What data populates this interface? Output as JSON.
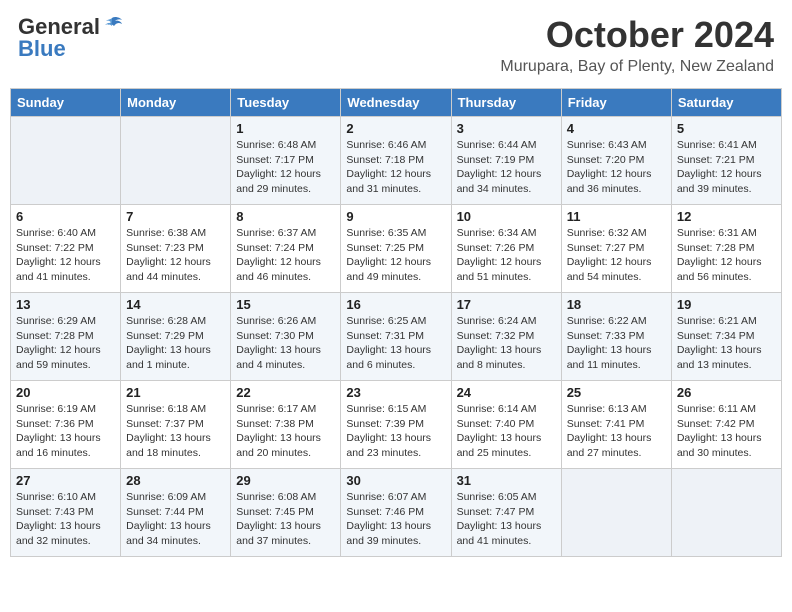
{
  "header": {
    "logo_general": "General",
    "logo_blue": "Blue",
    "month_title": "October 2024",
    "location": "Murupara, Bay of Plenty, New Zealand"
  },
  "weekdays": [
    "Sunday",
    "Monday",
    "Tuesday",
    "Wednesday",
    "Thursday",
    "Friday",
    "Saturday"
  ],
  "weeks": [
    [
      {
        "day": "",
        "info": ""
      },
      {
        "day": "",
        "info": ""
      },
      {
        "day": "1",
        "info": "Sunrise: 6:48 AM\nSunset: 7:17 PM\nDaylight: 12 hours\nand 29 minutes."
      },
      {
        "day": "2",
        "info": "Sunrise: 6:46 AM\nSunset: 7:18 PM\nDaylight: 12 hours\nand 31 minutes."
      },
      {
        "day": "3",
        "info": "Sunrise: 6:44 AM\nSunset: 7:19 PM\nDaylight: 12 hours\nand 34 minutes."
      },
      {
        "day": "4",
        "info": "Sunrise: 6:43 AM\nSunset: 7:20 PM\nDaylight: 12 hours\nand 36 minutes."
      },
      {
        "day": "5",
        "info": "Sunrise: 6:41 AM\nSunset: 7:21 PM\nDaylight: 12 hours\nand 39 minutes."
      }
    ],
    [
      {
        "day": "6",
        "info": "Sunrise: 6:40 AM\nSunset: 7:22 PM\nDaylight: 12 hours\nand 41 minutes."
      },
      {
        "day": "7",
        "info": "Sunrise: 6:38 AM\nSunset: 7:23 PM\nDaylight: 12 hours\nand 44 minutes."
      },
      {
        "day": "8",
        "info": "Sunrise: 6:37 AM\nSunset: 7:24 PM\nDaylight: 12 hours\nand 46 minutes."
      },
      {
        "day": "9",
        "info": "Sunrise: 6:35 AM\nSunset: 7:25 PM\nDaylight: 12 hours\nand 49 minutes."
      },
      {
        "day": "10",
        "info": "Sunrise: 6:34 AM\nSunset: 7:26 PM\nDaylight: 12 hours\nand 51 minutes."
      },
      {
        "day": "11",
        "info": "Sunrise: 6:32 AM\nSunset: 7:27 PM\nDaylight: 12 hours\nand 54 minutes."
      },
      {
        "day": "12",
        "info": "Sunrise: 6:31 AM\nSunset: 7:28 PM\nDaylight: 12 hours\nand 56 minutes."
      }
    ],
    [
      {
        "day": "13",
        "info": "Sunrise: 6:29 AM\nSunset: 7:28 PM\nDaylight: 12 hours\nand 59 minutes."
      },
      {
        "day": "14",
        "info": "Sunrise: 6:28 AM\nSunset: 7:29 PM\nDaylight: 13 hours\nand 1 minute."
      },
      {
        "day": "15",
        "info": "Sunrise: 6:26 AM\nSunset: 7:30 PM\nDaylight: 13 hours\nand 4 minutes."
      },
      {
        "day": "16",
        "info": "Sunrise: 6:25 AM\nSunset: 7:31 PM\nDaylight: 13 hours\nand 6 minutes."
      },
      {
        "day": "17",
        "info": "Sunrise: 6:24 AM\nSunset: 7:32 PM\nDaylight: 13 hours\nand 8 minutes."
      },
      {
        "day": "18",
        "info": "Sunrise: 6:22 AM\nSunset: 7:33 PM\nDaylight: 13 hours\nand 11 minutes."
      },
      {
        "day": "19",
        "info": "Sunrise: 6:21 AM\nSunset: 7:34 PM\nDaylight: 13 hours\nand 13 minutes."
      }
    ],
    [
      {
        "day": "20",
        "info": "Sunrise: 6:19 AM\nSunset: 7:36 PM\nDaylight: 13 hours\nand 16 minutes."
      },
      {
        "day": "21",
        "info": "Sunrise: 6:18 AM\nSunset: 7:37 PM\nDaylight: 13 hours\nand 18 minutes."
      },
      {
        "day": "22",
        "info": "Sunrise: 6:17 AM\nSunset: 7:38 PM\nDaylight: 13 hours\nand 20 minutes."
      },
      {
        "day": "23",
        "info": "Sunrise: 6:15 AM\nSunset: 7:39 PM\nDaylight: 13 hours\nand 23 minutes."
      },
      {
        "day": "24",
        "info": "Sunrise: 6:14 AM\nSunset: 7:40 PM\nDaylight: 13 hours\nand 25 minutes."
      },
      {
        "day": "25",
        "info": "Sunrise: 6:13 AM\nSunset: 7:41 PM\nDaylight: 13 hours\nand 27 minutes."
      },
      {
        "day": "26",
        "info": "Sunrise: 6:11 AM\nSunset: 7:42 PM\nDaylight: 13 hours\nand 30 minutes."
      }
    ],
    [
      {
        "day": "27",
        "info": "Sunrise: 6:10 AM\nSunset: 7:43 PM\nDaylight: 13 hours\nand 32 minutes."
      },
      {
        "day": "28",
        "info": "Sunrise: 6:09 AM\nSunset: 7:44 PM\nDaylight: 13 hours\nand 34 minutes."
      },
      {
        "day": "29",
        "info": "Sunrise: 6:08 AM\nSunset: 7:45 PM\nDaylight: 13 hours\nand 37 minutes."
      },
      {
        "day": "30",
        "info": "Sunrise: 6:07 AM\nSunset: 7:46 PM\nDaylight: 13 hours\nand 39 minutes."
      },
      {
        "day": "31",
        "info": "Sunrise: 6:05 AM\nSunset: 7:47 PM\nDaylight: 13 hours\nand 41 minutes."
      },
      {
        "day": "",
        "info": ""
      },
      {
        "day": "",
        "info": ""
      }
    ]
  ]
}
